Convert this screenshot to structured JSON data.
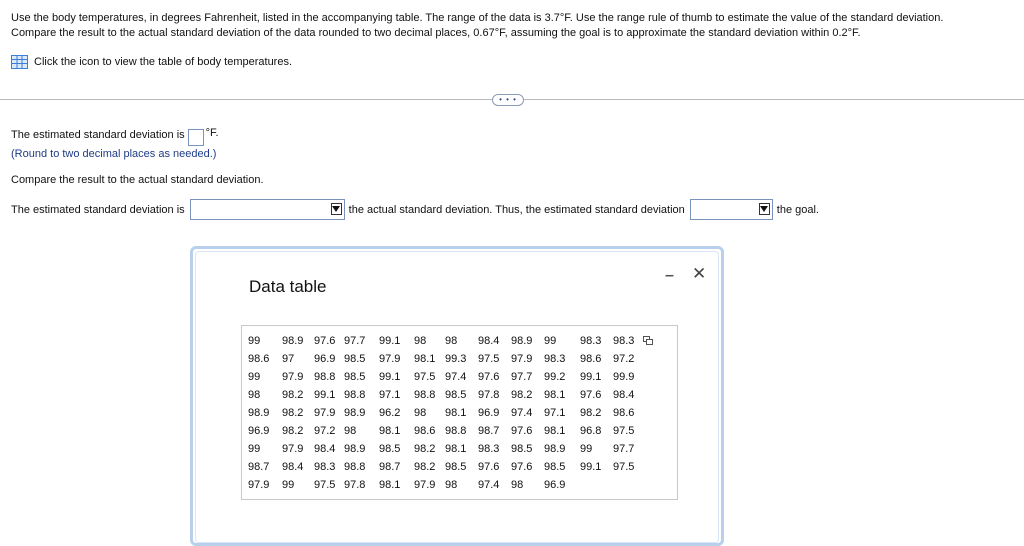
{
  "question": {
    "line1": "Use the body temperatures, in degrees Fahrenheit, listed in the accompanying table. The range of the data is 3.7°F. Use the range rule of thumb to estimate the value of the standard deviation.",
    "line2": "Compare the result to the actual standard deviation of the data rounded to two decimal places, 0.67°F, assuming the goal is to approximate the standard deviation within 0.2°F."
  },
  "table_link": {
    "label": "Click the icon to view the table of body temperatures.",
    "icon": "table-grid-icon"
  },
  "expand_button": {
    "label": "• • •"
  },
  "answer": {
    "estimated_prefix": "The estimated standard deviation is",
    "unit": "°F.",
    "round_hint": "(Round to two decimal places as needed.)",
    "compare_text": "Compare the result to the actual standard deviation.",
    "sentence_prefix": "The estimated standard deviation is",
    "sentence_middle": "the actual standard deviation. Thus, the estimated standard deviation",
    "sentence_suffix": "the goal.",
    "dropdown1_value": "",
    "dropdown2_value": ""
  },
  "modal": {
    "title": "Data table",
    "minimize_label": "–",
    "close_label": "✕",
    "rows": [
      [
        "99",
        "98.9",
        "97.6",
        "97.7",
        "99.1",
        "98",
        "98",
        "98.4",
        "98.9",
        "99",
        "98.3",
        "98.3"
      ],
      [
        "98.6",
        "97",
        "96.9",
        "98.5",
        "97.9",
        "98.1",
        "99.3",
        "97.5",
        "97.9",
        "98.3",
        "98.6",
        "97.2"
      ],
      [
        "99",
        "97.9",
        "98.8",
        "98.5",
        "99.1",
        "97.5",
        "97.4",
        "97.6",
        "97.7",
        "99.2",
        "99.1",
        "99.9"
      ],
      [
        "98",
        "98.2",
        "99.1",
        "98.8",
        "97.1",
        "98.8",
        "98.5",
        "97.8",
        "98.2",
        "98.1",
        "97.6",
        "98.4"
      ],
      [
        "98.9",
        "98.2",
        "97.9",
        "98.9",
        "96.2",
        "98",
        "98.1",
        "96.9",
        "97.4",
        "97.1",
        "98.2",
        "98.6"
      ],
      [
        "96.9",
        "98.2",
        "97.2",
        "98",
        "98.1",
        "98.6",
        "98.8",
        "98.7",
        "97.6",
        "98.1",
        "96.8",
        "97.5"
      ],
      [
        "99",
        "97.9",
        "98.4",
        "98.9",
        "98.5",
        "98.2",
        "98.1",
        "98.3",
        "98.5",
        "98.9",
        "99",
        "97.7"
      ],
      [
        "98.7",
        "98.4",
        "98.3",
        "98.8",
        "98.7",
        "98.2",
        "98.5",
        "97.6",
        "97.6",
        "98.5",
        "99.1",
        "97.5"
      ],
      [
        "97.9",
        "99",
        "97.5",
        "97.8",
        "98.1",
        "97.9",
        "98",
        "97.4",
        "98",
        "96.9"
      ]
    ]
  }
}
